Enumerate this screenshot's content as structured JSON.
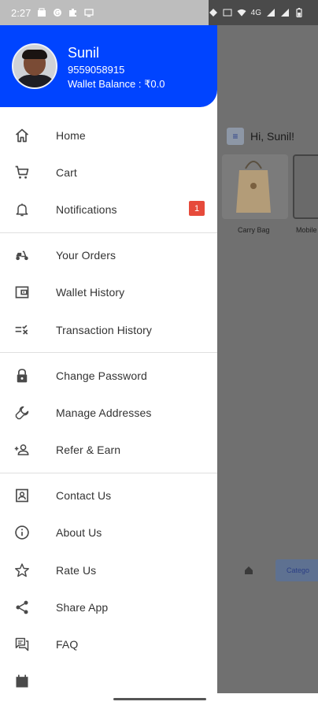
{
  "status_bar": {
    "time": "2:27",
    "network_label": "4G"
  },
  "drawer": {
    "profile": {
      "name": "Sunil",
      "phone": "9559058915",
      "wallet_label": "Wallet Balance :",
      "wallet_value": "₹0.0"
    },
    "sections": [
      [
        {
          "label": "Home",
          "icon": "home-icon"
        },
        {
          "label": "Cart",
          "icon": "cart-icon"
        },
        {
          "label": "Notifications",
          "icon": "bell-icon",
          "badge": "1"
        }
      ],
      [
        {
          "label": "Your Orders",
          "icon": "scooter-icon"
        },
        {
          "label": "Wallet History",
          "icon": "wallet-icon"
        },
        {
          "label": "Transaction History",
          "icon": "list-check-icon"
        }
      ],
      [
        {
          "label": "Change Password",
          "icon": "lock-icon"
        },
        {
          "label": "Manage Addresses",
          "icon": "wrench-icon"
        },
        {
          "label": "Refer & Earn",
          "icon": "person-add-icon"
        }
      ],
      [
        {
          "label": "Contact Us",
          "icon": "contact-icon"
        },
        {
          "label": "About Us",
          "icon": "info-icon"
        },
        {
          "label": "Rate Us",
          "icon": "star-icon"
        },
        {
          "label": "Share App",
          "icon": "share-icon"
        },
        {
          "label": "FAQ",
          "icon": "chat-icon"
        }
      ]
    ],
    "accent_color": "#0044ff"
  },
  "background_app": {
    "greeting": "Hi, Sunil!",
    "cards": [
      {
        "label": "Carry Bag"
      },
      {
        "label": "Mobile"
      }
    ],
    "category_button": "Catego"
  }
}
